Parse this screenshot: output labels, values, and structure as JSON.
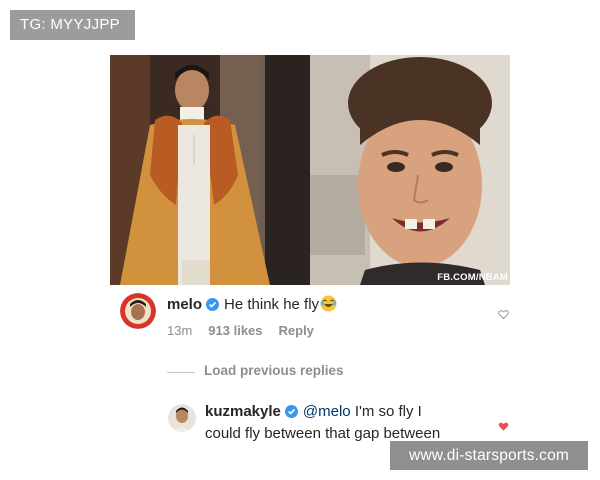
{
  "watermarks": {
    "top": "TG: MYYJJPP",
    "bottom": "www.di-starsports.com"
  },
  "photo": {
    "credit": "FB.COM/NBAM"
  },
  "comments": [
    {
      "username": "melo",
      "text": "He think he fly",
      "emoji": "laughing-emoji",
      "time": "13m",
      "likes": "913 likes",
      "reply": "Reply"
    }
  ],
  "load_previous": "Load previous replies",
  "reply": {
    "username": "kuzmakyle",
    "mention": "@melo",
    "text_line1": "I'm so fly I",
    "text_line2": "could fly between that gap between"
  },
  "colors": {
    "verified": "#3897f0",
    "like_heart": "#ed4956",
    "meta_text": "#8e8e8e"
  }
}
